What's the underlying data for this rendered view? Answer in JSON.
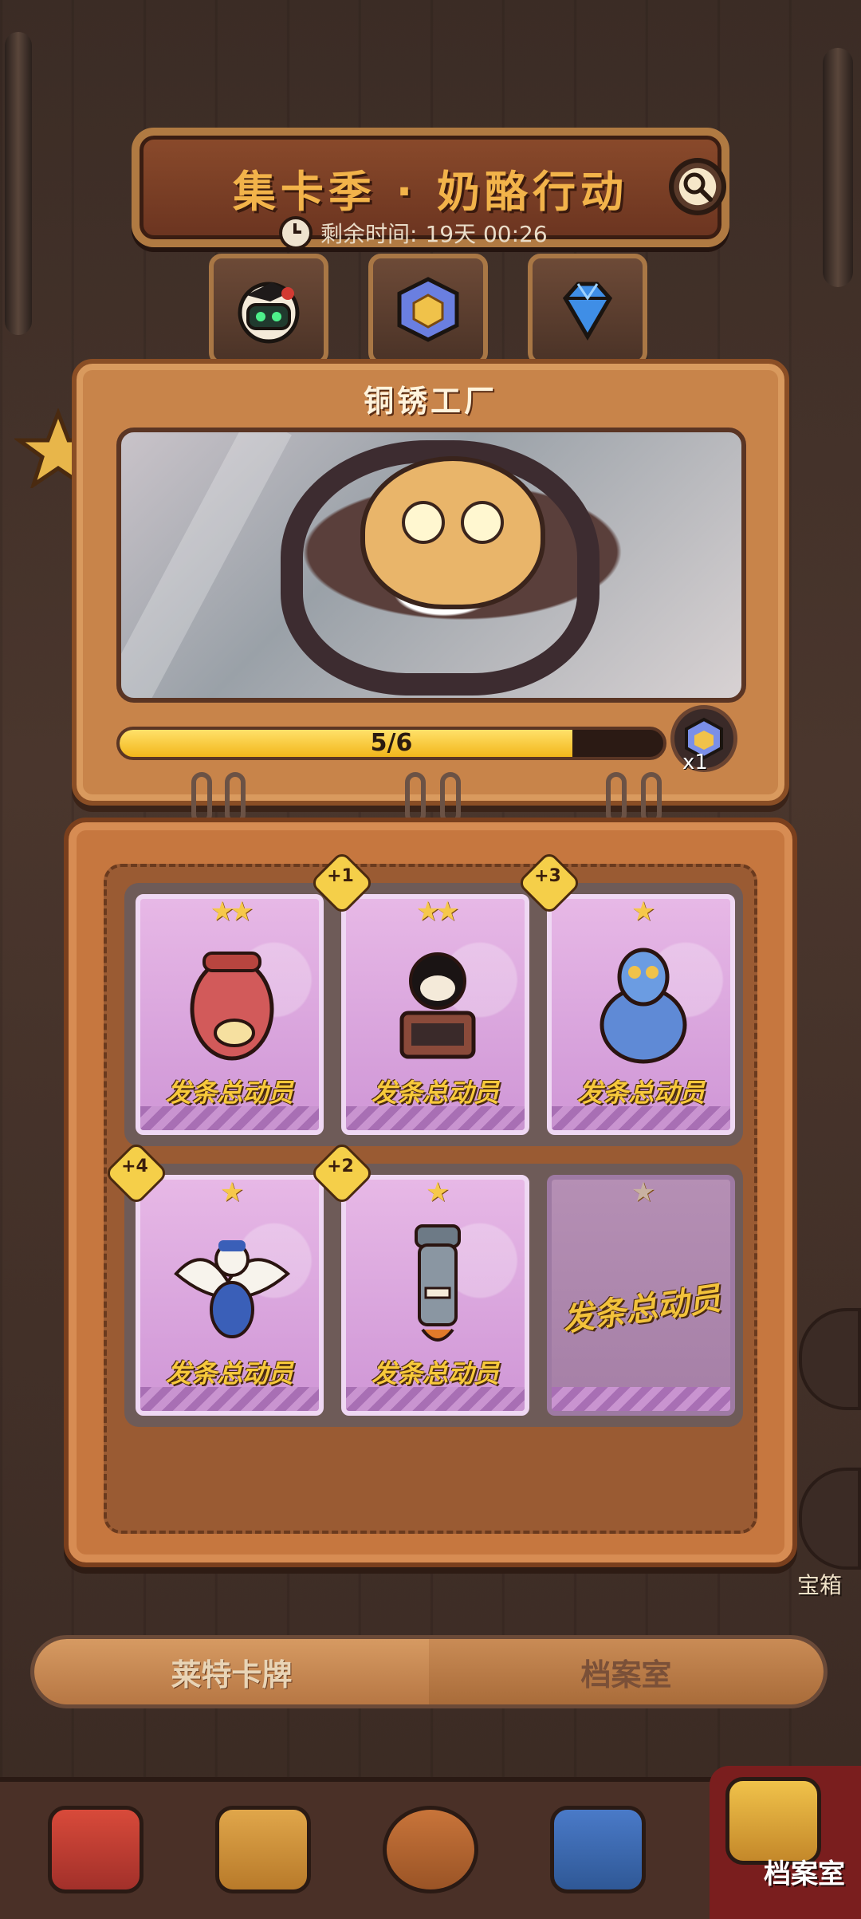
{
  "header": {
    "title": "集卡季 · 奶酪行动",
    "timer_label": "剩余时间:",
    "timer_value": "19天 00:26"
  },
  "top_tabs": [
    {
      "icon": "robot-icon"
    },
    {
      "icon": "cube-icon"
    },
    {
      "icon": "diamond-icon"
    }
  ],
  "album": {
    "title": "铜锈工厂",
    "progress_text": "5/6",
    "progress_fraction": 0.8333,
    "reward_qty": "x1"
  },
  "cards": [
    {
      "name": "发条总动员",
      "stars": "★★",
      "badge": ""
    },
    {
      "name": "发条总动员",
      "stars": "★★",
      "badge": "+1"
    },
    {
      "name": "发条总动员",
      "stars": "★",
      "badge": "+3"
    },
    {
      "name": "发条总动员",
      "stars": "★",
      "badge": "+4"
    },
    {
      "name": "发条总动员",
      "stars": "★",
      "badge": "+2"
    },
    {
      "name": "发条总动员",
      "stars": "★",
      "badge": ""
    }
  ],
  "side": {
    "chest_label": "宝箱"
  },
  "segment_tabs": {
    "left": "莱特卡牌",
    "right": "档案室"
  },
  "bottom_nav": {
    "active_label": "档案室"
  },
  "colors": {
    "accent_gold": "#f2b34a",
    "progress_fill": "#f2b61b",
    "card_bg": "#e7b8e6",
    "active_nav": "#7a1e1e"
  }
}
